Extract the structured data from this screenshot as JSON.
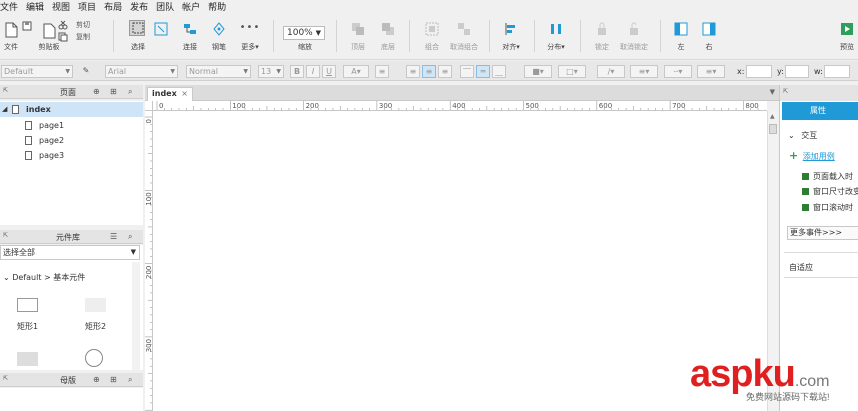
{
  "menu": [
    "文件",
    "编辑",
    "视图",
    "项目",
    "布局",
    "发布",
    "团队",
    "帐户",
    "帮助"
  ],
  "toolbar": {
    "file": "文件",
    "clipboard": "剪贴板",
    "cut": "剪切",
    "copy": "复制",
    "select": "选择",
    "connect": "连接",
    "pen": "钢笔",
    "more": "更多▾",
    "zoom_value": "100%",
    "zoom_label": "缩放",
    "top": "顶层",
    "bottom": "底层",
    "group": "组合",
    "ungroup": "取消组合",
    "align": "对齐▾",
    "distribute": "分布▾",
    "lock": "锁定",
    "unlock": "取消锁定",
    "left": "左",
    "right": "右",
    "preview": "预览"
  },
  "format": {
    "style": "Default",
    "font": "Arial",
    "weight": "Normal",
    "size": "13",
    "x_label": "x:",
    "y_label": "y:",
    "w_label": "w:"
  },
  "pages_panel": {
    "title": "页面",
    "root": "index",
    "pages": [
      "page1",
      "page2",
      "page3"
    ]
  },
  "widget_panel": {
    "title": "元件库",
    "select": "选择全部",
    "library": "Default > 基本元件",
    "widgets": [
      "矩形1",
      "矩形2"
    ]
  },
  "masters_panel": {
    "title": "母版"
  },
  "tab": {
    "label": "index",
    "close": "×"
  },
  "ruler": {
    "h": [
      "0",
      "100",
      "200",
      "300",
      "400",
      "500",
      "600",
      "700",
      "800"
    ],
    "v": [
      "0",
      "100",
      "200",
      "300"
    ]
  },
  "right_panel": {
    "tab": "属性",
    "interaction": "交互",
    "add_case": "添加用例",
    "events": [
      "页面载入时",
      "窗口尺寸改变时",
      "窗口滚动时"
    ],
    "more_events": "更多事件>>>",
    "adaptive": "自适应"
  },
  "watermark": {
    "brand": "aspku",
    "suffix": ".com",
    "sub": "免费网站源码下载站!"
  },
  "colors": {
    "accent": "#1f9ad6",
    "selected_row": "#cfe4f7",
    "watermark": "#e02020"
  }
}
